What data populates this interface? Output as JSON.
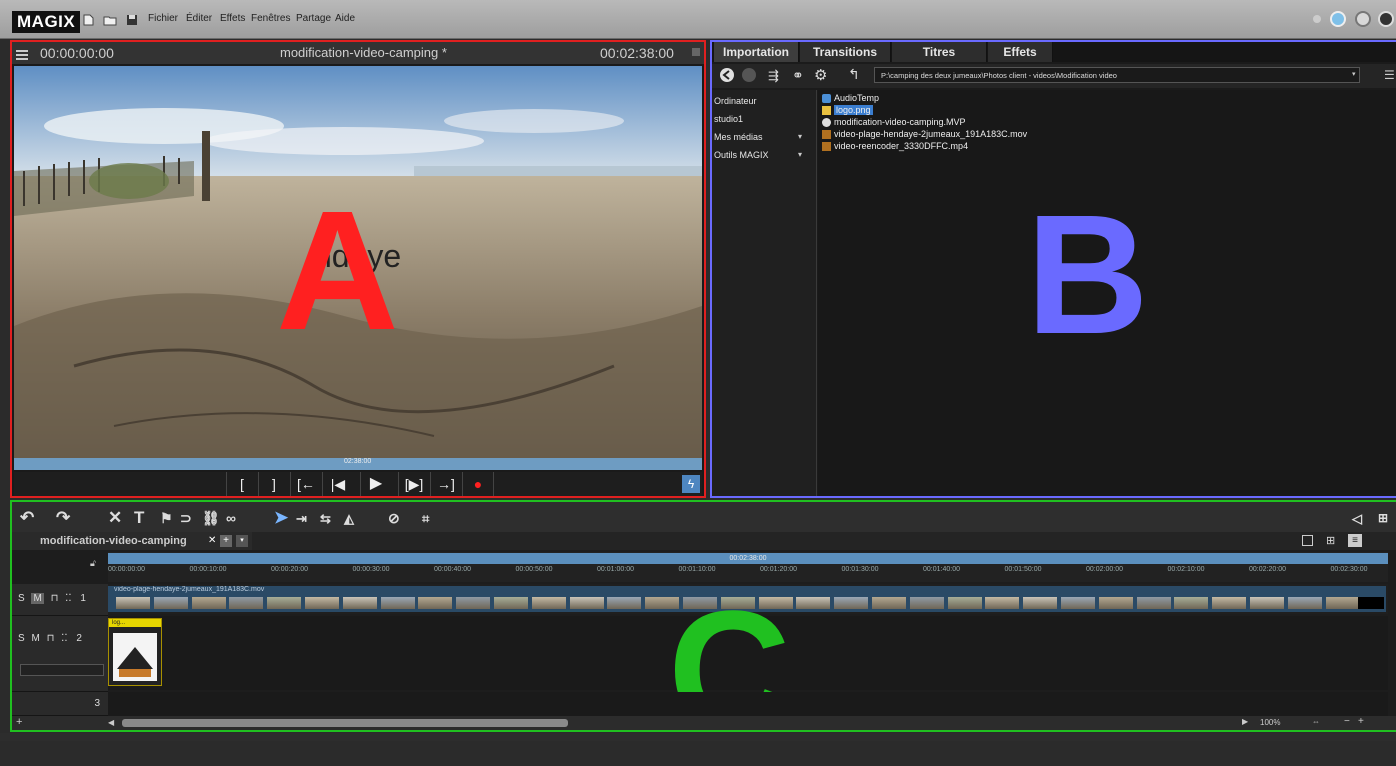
{
  "menubar": {
    "logo": "MAGIX",
    "items": [
      "Fichier",
      "Éditer",
      "Effets",
      "Fenêtres",
      "Partage",
      "Aide"
    ]
  },
  "preview": {
    "timecode_start": "00:00:00:00",
    "title": "modification-video-camping *",
    "timecode_end": "00:02:38:00",
    "overlay_text": "ndaye",
    "progress_label": "02:38:00",
    "marker_letter": "A",
    "transport": [
      "[",
      "]",
      "[←",
      "|◀",
      "▶",
      "[▶]",
      "→]",
      "●"
    ],
    "quick_icon": "ϟ"
  },
  "browser": {
    "tabs": [
      "Importation",
      "Transitions",
      "Titres",
      "Effets"
    ],
    "path": "P:\\camping des deux jumeaux\\Photos client - videos\\Modification video",
    "tree": [
      {
        "label": "Ordinateur"
      },
      {
        "label": "studio1"
      },
      {
        "label": "Mes médias"
      },
      {
        "label": "Outils MAGIX"
      }
    ],
    "files": [
      {
        "name": "AudioTemp",
        "icon": "folder-icon"
      },
      {
        "name": "logo.png",
        "icon": "image-icon",
        "selected": true
      },
      {
        "name": "modification-video-camping.MVP",
        "icon": "project-icon"
      },
      {
        "name": "video-plage-hendaye-2jumeaux_191A183C.mov",
        "icon": "video-icon"
      },
      {
        "name": "video-reencoder_3330DFFC.mp4",
        "icon": "video-icon"
      }
    ],
    "marker_letter": "B"
  },
  "timeline": {
    "project_tab": "modification-video-camping",
    "ruler_top": "00:02:38:00",
    "ticks": [
      "00:00:00:00",
      "00:00:10:00",
      "00:00:20:00",
      "00:00:30:00",
      "00:00:40:00",
      "00:00:50:00",
      "00:01:00:00",
      "00:01:10:00",
      "00:01:20:00",
      "00:01:30:00",
      "00:01:40:00",
      "00:01:50:00",
      "00:02:00:00",
      "00:02:10:00",
      "00:02:20:00",
      "00:02:30:00"
    ],
    "tracks": [
      {
        "number": "1",
        "clip": "video-plage-hendaye-2jumeaux_191A183C.mov"
      },
      {
        "number": "2",
        "clip": "log..."
      },
      {
        "number": "3"
      }
    ],
    "zoom": "100%",
    "marker_letter": "C"
  },
  "colors": {
    "panel_a": "#e02020",
    "panel_b": "#6a6aff",
    "panel_c": "#20c020"
  }
}
